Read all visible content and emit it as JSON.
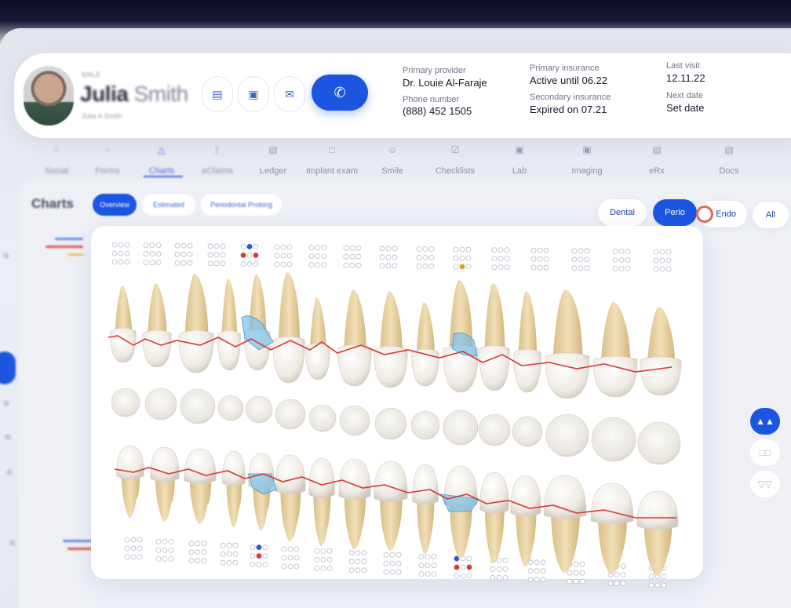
{
  "patient": {
    "meta_top": "MALE",
    "first_name": "Julia",
    "last_name": "Smith",
    "meta_bottom": "Julia A Smith"
  },
  "header_actions": {
    "icons": [
      "clipboard-icon",
      "calendar-icon",
      "mail-icon",
      "phone-icon"
    ]
  },
  "info": {
    "primary_provider_label": "Primary provider",
    "primary_provider": "Dr. Louie Al-Faraje",
    "phone_label": "Phone number",
    "phone": "(888) 452 1505",
    "primary_insurance_label": "Primary insurance",
    "primary_insurance": "Active until 06.22",
    "secondary_insurance_label": "Secondary insurance",
    "secondary_insurance": "Expired on 07.21",
    "last_visit_label": "Last visit",
    "last_visit": "12.11.22",
    "next_date_label": "Next date",
    "next_date": "Set date"
  },
  "nav": {
    "items": [
      {
        "label": "Social",
        "icon": "user-icon"
      },
      {
        "label": "Forms",
        "icon": "form-icon"
      },
      {
        "label": "Charts",
        "icon": "tooth-icon"
      },
      {
        "label": "eClaims",
        "icon": "claim-icon"
      },
      {
        "label": "Ledger",
        "icon": "ledger-icon"
      },
      {
        "label": "Implant exam",
        "icon": "folder-icon"
      },
      {
        "label": "Smile",
        "icon": "smile-icon"
      },
      {
        "label": "Checklists",
        "icon": "checklist-icon"
      },
      {
        "label": "Lab",
        "icon": "lab-icon"
      },
      {
        "label": "Imaging",
        "icon": "imaging-icon"
      },
      {
        "label": "eRx",
        "icon": "rx-icon"
      },
      {
        "label": "Docs",
        "icon": "docs-icon"
      }
    ],
    "active": "Charts"
  },
  "charts": {
    "title": "Charts",
    "sub_tabs": [
      "Overview",
      "Estimated",
      "Periodontal Probing"
    ],
    "active_sub_tab": "Overview",
    "filters": [
      "Dental",
      "Perio",
      "Endo",
      "All"
    ],
    "active_filter": "Perio"
  },
  "colors": {
    "accent": "#1c56e0",
    "gumline": "#d43a3a",
    "probing_fill": "#7cc1e8",
    "endo_marker": "#e06a4e",
    "tooth": "#e9dcc2",
    "root": "#e7cf9d"
  }
}
